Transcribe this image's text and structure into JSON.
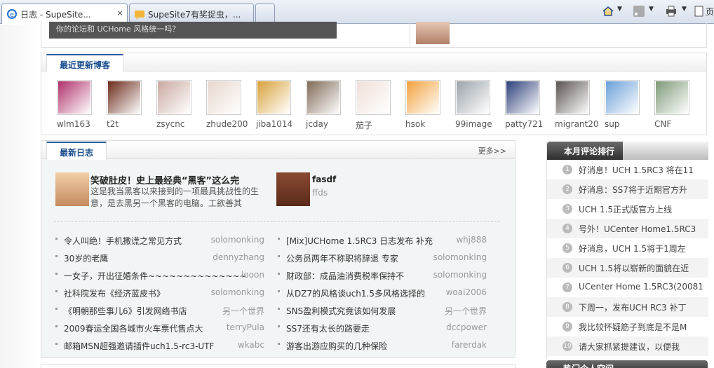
{
  "browser": {
    "tabs": [
      {
        "title": "日志 - SupeSite..."
      },
      {
        "title": "SupeSite7有奖捉虫，..."
      }
    ],
    "toolbar": {
      "page_label": "页"
    }
  },
  "top": {
    "banner_text": "你的论坛和 UCHome 风格统一吗？"
  },
  "recent_blogs": {
    "title": "最近更新博客",
    "bloggers": [
      {
        "name": "wlm163",
        "color": "#b0306a"
      },
      {
        "name": "t2t",
        "color": "#6b2a1a"
      },
      {
        "name": "zsycnc",
        "color": "#c9a9a0"
      },
      {
        "name": "zhude200",
        "color": "#e7d6cc"
      },
      {
        "name": "jiba1014",
        "color": "#d8a23a"
      },
      {
        "name": "jcday",
        "color": "#7f6a56"
      },
      {
        "name": "茄子",
        "color": "#f0e0d8"
      },
      {
        "name": "hsok",
        "color": "#f2a23c"
      },
      {
        "name": "99image",
        "color": "#9aa3aa"
      },
      {
        "name": "patty721",
        "color": "#2d3f7a"
      },
      {
        "name": "migrant20",
        "color": "#5a5350"
      },
      {
        "name": "sup",
        "color": "#6aa0d8"
      },
      {
        "name": "CNF",
        "color": "#7e9a78"
      }
    ]
  },
  "latest_logs": {
    "title": "最新日志",
    "more": "更多>>",
    "feature": {
      "title": "笑破肚皮！史上最经典“黑客”这么完",
      "text": "这是我当黑客以来接到的一项最具挑战性的生意，是去黑另一个黑客的电脑。工欲善其"
    },
    "feature2": {
      "title": "fasdf",
      "text": "ffds"
    },
    "left_items": [
      {
        "title": "令人叫绝！手机撒谎之常见方式",
        "author": "solomonking"
      },
      {
        "title": "30岁的老鹰",
        "author": "dennyzhang"
      },
      {
        "title": "一女子，开出征婚条件~~~~~~~~~~~~~~",
        "author": "looon"
      },
      {
        "title": "社科院发布《经济蓝皮书》",
        "author": "solomonking"
      },
      {
        "title": "《明朝那些事儿6》引发网络书店",
        "author": "另一个世界"
      },
      {
        "title": "2009春运全国各城市火车票代售点大",
        "author": "terryPula"
      },
      {
        "title": "邮箱MSN超强邀请插件uch1.5-rc3-UTF",
        "author": "wkabc"
      }
    ],
    "right_items": [
      {
        "title": "[Mix]UCHome 1.5RC3 日志发布 补充",
        "author": "whj888"
      },
      {
        "title": "公务员两年不称职将辞退 专家",
        "author": "solomonking"
      },
      {
        "title": "财政部：成品油消费税率保持不",
        "author": "solomonking"
      },
      {
        "title": "从DZ7的风格谈uch1.5多风格选择的",
        "author": "woai2006"
      },
      {
        "title": "SNS盈利模式究竟该如何发展",
        "author": "另一个世界"
      },
      {
        "title": "SS7还有太长的路要走",
        "author": "dccpower"
      },
      {
        "title": "游客出游应购买的几种保险",
        "author": "farerdak"
      }
    ]
  },
  "monthly_comments": {
    "title": "本月评论排行",
    "items": [
      {
        "num": "1",
        "text": "好消息！UCH 1.5RC3 将在11"
      },
      {
        "num": "2",
        "text": "好消息：SS7将于近期官方升"
      },
      {
        "num": "3",
        "text": "UCH 1.5正式版官方上线"
      },
      {
        "num": "4",
        "text": "号外！UCenter Home1.5RC3"
      },
      {
        "num": "5",
        "text": "好消息，UCH 1.5将于1周左"
      },
      {
        "num": "6",
        "text": "UCH 1.5将以崭新的面貌在近"
      },
      {
        "num": "7",
        "text": "UCenter Home 1.5RC3(20081"
      },
      {
        "num": "8",
        "text": "下周一，发布UCH RC3 补丁"
      },
      {
        "num": "9",
        "text": "我比较怀疑筋子到底是不是M"
      },
      {
        "num": "10",
        "text": "请大家抓紧提建议，以便我"
      }
    ]
  },
  "next_panel": {
    "title": "热门个人空间"
  }
}
